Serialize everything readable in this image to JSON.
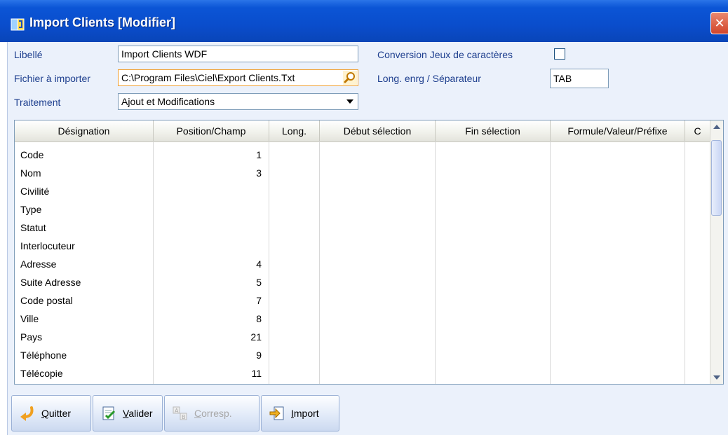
{
  "window": {
    "title": "Import Clients [Modifier]",
    "close_glyph": "✕"
  },
  "form": {
    "libelle_label": "Libellé",
    "libelle_value": "Import Clients WDF",
    "fichier_label": "Fichier à importer",
    "fichier_value": "C:\\Program Files\\Ciel\\Export Clients.Txt",
    "traitement_label": "Traitement",
    "traitement_value": "Ajout et Modifications",
    "conversion_label": "Conversion Jeux de caractères",
    "conversion_checked": false,
    "long_label": "Long. enrg / Séparateur",
    "long_value": "TAB"
  },
  "grid": {
    "columns": [
      "Désignation",
      "Position/Champ",
      "Long.",
      "Début sélection",
      "Fin sélection",
      "Formule/Valeur/Préfixe",
      "C"
    ],
    "rows": [
      {
        "name": "Code",
        "pos": "1"
      },
      {
        "name": "Nom",
        "pos": "3"
      },
      {
        "name": "Civilité",
        "pos": ""
      },
      {
        "name": "Type",
        "pos": ""
      },
      {
        "name": "Statut",
        "pos": ""
      },
      {
        "name": "Interlocuteur",
        "pos": ""
      },
      {
        "name": "Adresse",
        "pos": "4"
      },
      {
        "name": "Suite Adresse",
        "pos": "5"
      },
      {
        "name": "Code postal",
        "pos": "7"
      },
      {
        "name": "Ville",
        "pos": "8"
      },
      {
        "name": "Pays",
        "pos": "21"
      },
      {
        "name": "Téléphone",
        "pos": "9"
      },
      {
        "name": "Télécopie",
        "pos": "11"
      }
    ]
  },
  "buttons": {
    "quitter": {
      "accel": "Q",
      "rest": "uitter"
    },
    "valider": {
      "accel": "V",
      "rest": "alider"
    },
    "corresp": {
      "accel": "C",
      "rest": "orresp."
    },
    "import": {
      "accel": "I",
      "rest": "mport"
    }
  },
  "colors": {
    "title_bar": "#0a4dcc",
    "label_text": "#1d3e8e",
    "highlight_border": "#f0a030",
    "disabled_text": "#a7a7a7"
  }
}
